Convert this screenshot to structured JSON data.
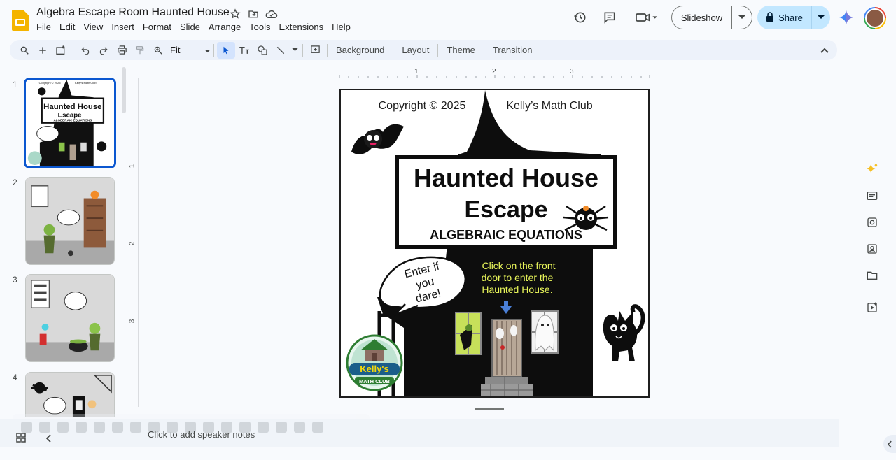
{
  "app": {
    "doc_title": "Algebra Escape Room Haunted House",
    "menu": [
      "File",
      "Edit",
      "View",
      "Insert",
      "Format",
      "Slide",
      "Arrange",
      "Tools",
      "Extensions",
      "Help"
    ],
    "slideshow_label": "Slideshow",
    "share_label": "Share"
  },
  "toolbar": {
    "zoom_value": "Fit",
    "background_label": "Background",
    "layout_label": "Layout",
    "theme_label": "Theme",
    "transition_label": "Transition"
  },
  "filmstrip": {
    "slide_numbers": [
      "1",
      "2",
      "3",
      "4"
    ],
    "selected_slide": 1,
    "thumb1": {
      "copyright": "Copyright © 2025",
      "club": "Kelly's Math Club",
      "title1": "Haunted House",
      "title2": "Escape",
      "subtitle": "ALGEBRAIC EQUATIONS",
      "bubble": "Enter if you dare!",
      "instruction": "Click on the front door to enter the Haunted House."
    }
  },
  "ruler": {
    "h_marks": [
      "1",
      "2",
      "3"
    ],
    "v_marks": [
      "1",
      "2",
      "3"
    ]
  },
  "slide": {
    "copyright": "Copyright © 2025",
    "club": "Kelly’s Math Club",
    "title_line1": "Haunted House",
    "title_line2": "Escape",
    "subtitle": "ALGEBRAIC EQUATIONS",
    "bubble_line1": "Enter if",
    "bubble_line2": "you",
    "bubble_line3": "dare!",
    "instruction_line1": "Click on the front",
    "instruction_line2": "door to enter the",
    "instruction_line3": "Haunted House.",
    "logo_text": "Kelly's",
    "logo_sub": "MATH CLUB"
  },
  "notes": {
    "placeholder": "Click to add speaker notes"
  },
  "colors": {
    "accent_blue": "#0b57d0",
    "share_bg": "#c2e7ff",
    "toolbar_bg": "#edf2fa",
    "instruction_text": "#e8f55a"
  }
}
